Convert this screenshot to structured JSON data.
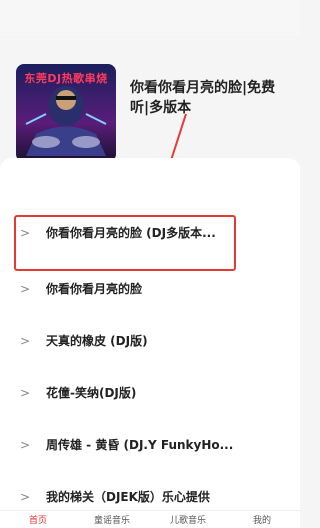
{
  "album": {
    "cover_text": "东莞DJ热歌串烧",
    "title": "你看你看月亮的脸|免费听|多版本"
  },
  "songs": [
    {
      "arrow": ">",
      "title": "你看你看月亮的脸 (DJ多版本..."
    },
    {
      "arrow": ">",
      "title": "你看你看月亮的脸"
    },
    {
      "arrow": ">",
      "title": "天真的橡皮 (DJ版)"
    },
    {
      "arrow": ">",
      "title": "花僮-笑纳(DJ版)"
    },
    {
      "arrow": ">",
      "title": "周传雄 - 黄昏 (DJ.Y FunkyHo..."
    },
    {
      "arrow": ">",
      "title": "我的梯关（DJEK版）乐心提供"
    }
  ],
  "tabs": [
    {
      "label": "首页"
    },
    {
      "label": "童谣音乐"
    },
    {
      "label": "儿歌音乐"
    },
    {
      "label": "我的"
    }
  ],
  "colors": {
    "accent": "#e53935",
    "cover_text": "#ff3b5c"
  }
}
